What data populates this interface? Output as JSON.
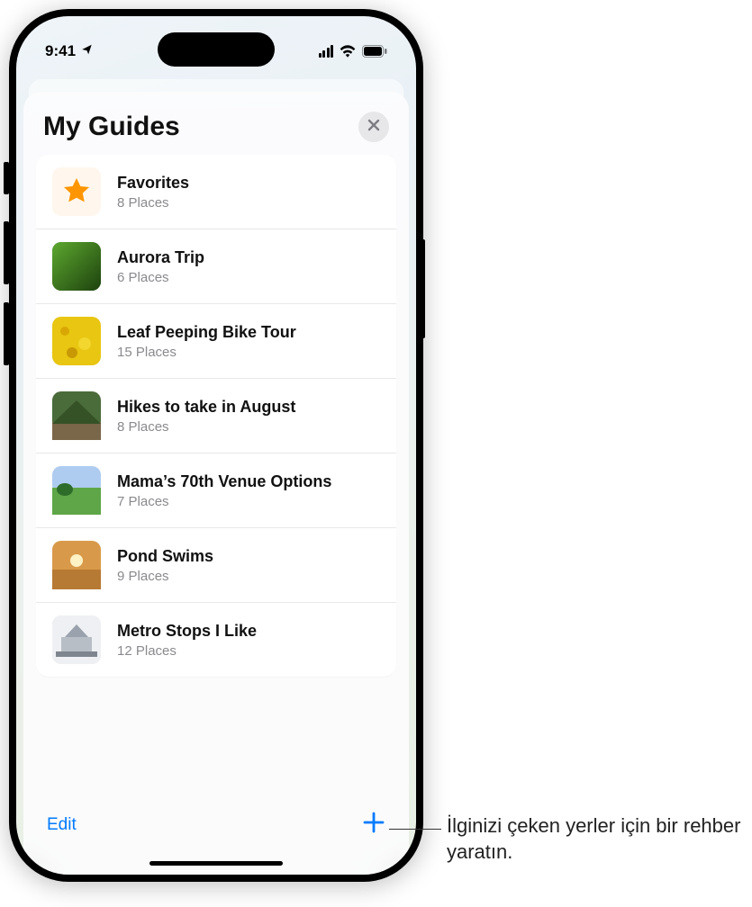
{
  "status": {
    "time": "9:41",
    "locationActive": true
  },
  "sheet": {
    "title": "My Guides",
    "closeLabel": "Close",
    "editLabel": "Edit",
    "addLabel": "Add"
  },
  "guides": [
    {
      "title": "Favorites",
      "sub": "8 Places",
      "thumb": "favorites"
    },
    {
      "title": "Aurora Trip",
      "sub": "6 Places",
      "thumb": "green-grass"
    },
    {
      "title": "Leaf Peeping Bike Tour",
      "sub": "15 Places",
      "thumb": "yellow-leaves"
    },
    {
      "title": "Hikes to take in August",
      "sub": "8 Places",
      "thumb": "forest-path"
    },
    {
      "title": "Mama’s 70th Venue Options",
      "sub": "7 Places",
      "thumb": "green-field"
    },
    {
      "title": "Pond Swims",
      "sub": "9 Places",
      "thumb": "pond-sunset"
    },
    {
      "title": "Metro Stops I Like",
      "sub": "12 Places",
      "thumb": "metro-building"
    }
  ],
  "callout": {
    "text": "İlginizi çeken yerler için bir rehber yaratın."
  }
}
